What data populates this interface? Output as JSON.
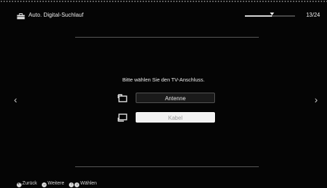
{
  "header": {
    "title": "Auto. Digital-Suchlauf",
    "step": "13/24",
    "progress": 0.54
  },
  "prompt": "Bitte wählen Sie den TV-Anschluss.",
  "options": [
    {
      "label": "Antenne",
      "icon": "antenna-input-icon",
      "selected": false
    },
    {
      "label": "Kabel",
      "icon": "cable-input-icon",
      "selected": true
    }
  ],
  "nav": {
    "prev_glyph": "‹",
    "next_glyph": "›"
  },
  "footer": {
    "back": {
      "glyph": "↶",
      "label": "Zurück"
    },
    "next": {
      "glyph": "→",
      "label": "Weitere"
    },
    "select": {
      "glyph_up": "↑",
      "glyph_down": "↓",
      "label": "Wählen"
    }
  },
  "colors": {
    "background": "#050505",
    "text": "#e8e8e8",
    "highlight": "#f2f2f2"
  }
}
